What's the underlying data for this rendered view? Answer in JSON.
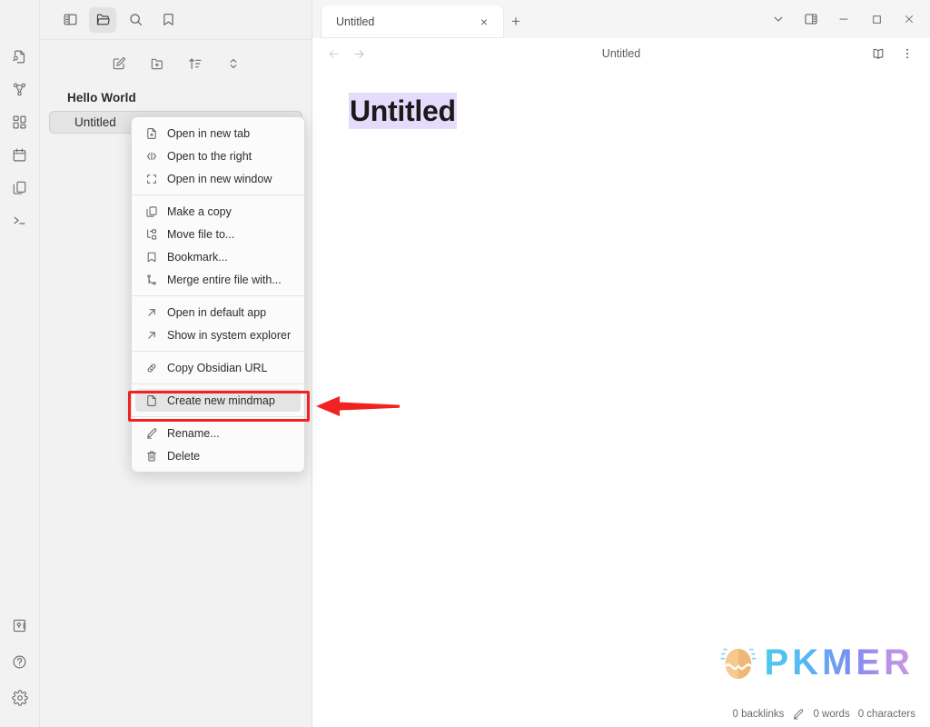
{
  "ribbon": {
    "top_toggles": [
      {
        "name": "toggle-left-sidebar-icon",
        "label": "Toggle left sidebar"
      },
      {
        "name": "files-icon",
        "label": "Files"
      },
      {
        "name": "search-icon",
        "label": "Search"
      },
      {
        "name": "bookmarks-icon",
        "label": "Bookmarks"
      }
    ],
    "items": [
      {
        "name": "quick-switcher-icon",
        "label": "Quick switcher"
      },
      {
        "name": "graph-view-icon",
        "label": "Graph view"
      },
      {
        "name": "canvas-icon",
        "label": "Canvas"
      },
      {
        "name": "daily-note-icon",
        "label": "Daily note"
      },
      {
        "name": "templates-icon",
        "label": "Templates"
      },
      {
        "name": "terminal-icon",
        "label": "Terminal"
      }
    ],
    "bottom_items": [
      {
        "name": "vault-icon",
        "label": "Open another vault"
      },
      {
        "name": "help-icon",
        "label": "Help"
      },
      {
        "name": "settings-gear-icon",
        "label": "Settings"
      }
    ]
  },
  "explorer": {
    "toolbar": [
      {
        "name": "new-note-icon",
        "label": "New note"
      },
      {
        "name": "new-folder-icon",
        "label": "New folder"
      },
      {
        "name": "sort-order-icon",
        "label": "Change sort order"
      },
      {
        "name": "collapse-expand-icon",
        "label": "Expand or collapse all"
      }
    ],
    "tree": {
      "folder": "Hello World",
      "file": "Untitled"
    }
  },
  "tabs": {
    "active_tab_label": "Untitled",
    "close_glyph": "×",
    "new_tab_glyph": "+"
  },
  "window_controls": [
    {
      "name": "tab-list-chevron-icon",
      "label": "v"
    },
    {
      "name": "toggle-right-sidebar-icon",
      "label": "Toggle right sidebar"
    },
    {
      "name": "minimize-icon",
      "label": "Minimize"
    },
    {
      "name": "maximize-icon",
      "label": "Maximize"
    },
    {
      "name": "close-window-icon",
      "label": "Close"
    }
  ],
  "view_header": {
    "back_label": "Back",
    "forward_label": "Forward",
    "title": "Untitled",
    "reading_view_label": "Reading view",
    "more_options_label": "More options"
  },
  "editor": {
    "document_title": "Untitled"
  },
  "context_menu": {
    "groups": [
      {
        "items": [
          {
            "icon": "file-plus-icon",
            "label": "Open in new tab"
          },
          {
            "icon": "split-right-icon",
            "label": "Open to the right"
          },
          {
            "icon": "new-window-icon",
            "label": "Open in new window"
          }
        ]
      },
      {
        "items": [
          {
            "icon": "copy-icon",
            "label": "Make a copy"
          },
          {
            "icon": "move-file-icon",
            "label": "Move file to..."
          },
          {
            "icon": "bookmark-icon",
            "label": "Bookmark..."
          },
          {
            "icon": "merge-icon",
            "label": "Merge entire file with..."
          }
        ]
      },
      {
        "items": [
          {
            "icon": "external-link-icon",
            "label": "Open in default app"
          },
          {
            "icon": "external-link-icon",
            "label": "Show in system explorer"
          }
        ]
      },
      {
        "items": [
          {
            "icon": "link-icon",
            "label": "Copy Obsidian URL"
          }
        ]
      },
      {
        "items": [
          {
            "icon": "file-icon",
            "label": "Create new mindmap",
            "highlighted": true
          }
        ]
      },
      {
        "items": [
          {
            "icon": "pencil-icon",
            "label": "Rename..."
          },
          {
            "icon": "trash-icon",
            "label": "Delete"
          }
        ]
      }
    ]
  },
  "annotation": {
    "highlight_color": "#f02222",
    "arrow_color": "#f02222",
    "target_label": "Create new mindmap"
  },
  "watermark": {
    "text": "PKMER"
  },
  "status_bar": {
    "backlinks": "0 backlinks",
    "words": "0 words",
    "characters": "0 characters",
    "edit_icon": "pencil-icon"
  }
}
